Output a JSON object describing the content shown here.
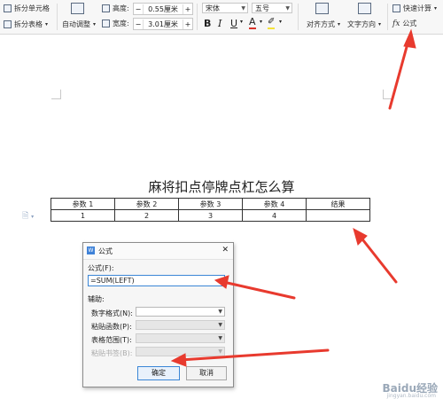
{
  "ribbon": {
    "split_cell": "拆分单元格",
    "split_table": "拆分表格",
    "auto_fit": "自动调整",
    "height_label": "高度:",
    "height_value": "0.55厘米",
    "width_label": "宽度:",
    "width_value": "3.01厘米",
    "minus": "−",
    "plus": "+",
    "font_name": "宋体",
    "font_size": "五号",
    "bold": "B",
    "italic": "I",
    "underline": "U",
    "font_color": "A",
    "highlight": "✐",
    "align": "对齐方式",
    "text_dir": "文字方向",
    "quick_calc": "快速计算",
    "formula_fx": "fx",
    "formula": "公式"
  },
  "document": {
    "title": "麻将扣点停牌点杠怎么算",
    "table": {
      "headers": [
        "参数 1",
        "参数 2",
        "参数 3",
        "参数 4",
        "结果"
      ],
      "row": [
        "1",
        "2",
        "3",
        "4",
        ""
      ]
    }
  },
  "dialog": {
    "icon_text": "W",
    "title": "公式",
    "close": "✕",
    "formula_label": "公式(F):",
    "formula_value": "=SUM(LEFT)",
    "aux_label": "辅助:",
    "number_format_label": "数字格式(N):",
    "paste_function_label": "粘贴函数(P):",
    "table_range_label": "表格范围(T):",
    "paste_bookmark_label": "粘贴书签(B):",
    "ok": "确定",
    "cancel": "取消"
  },
  "watermark": {
    "text": "Baidu经验",
    "sub": "jingyan.baidu.com"
  },
  "colors": {
    "arrow": "#e83a2e",
    "accent": "#3b86d6",
    "font_color_bar": "#d8342a",
    "highlight_bar": "#f4e23a"
  }
}
